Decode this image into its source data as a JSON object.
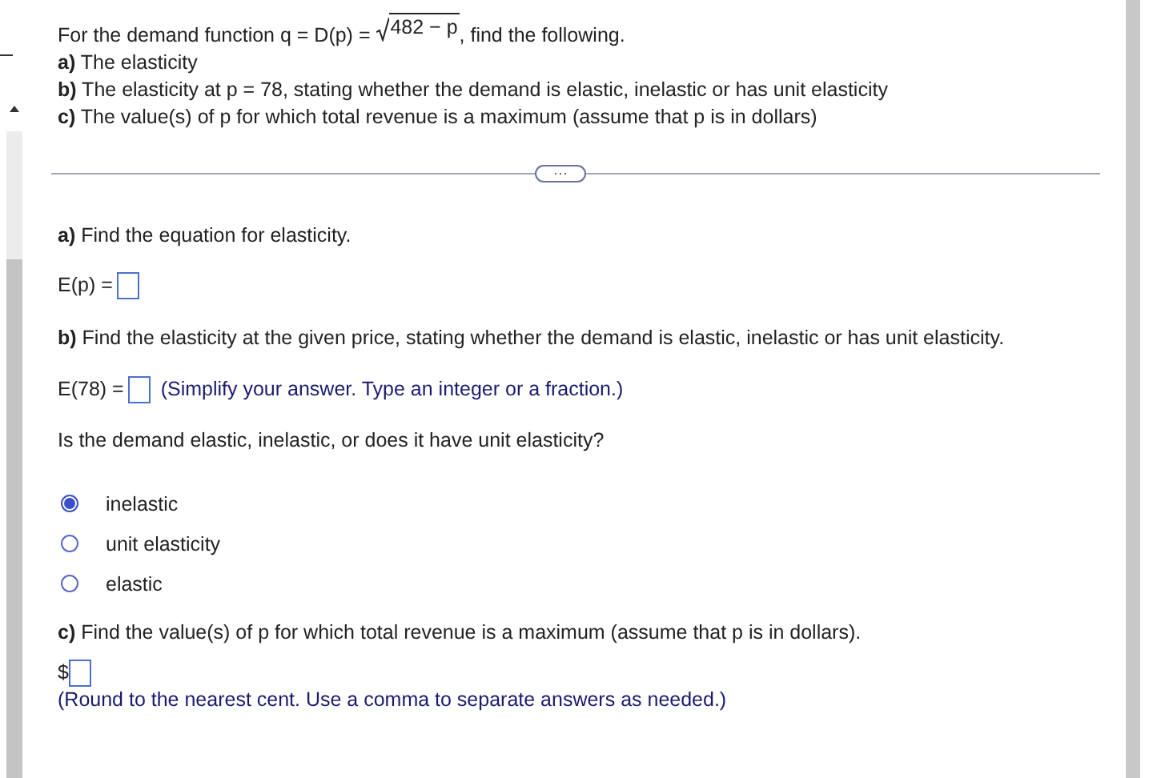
{
  "question": {
    "intro_before": "For the demand function q = D(p) = ",
    "radicand": "482 −  p",
    "intro_after": ", find the following.",
    "parts": [
      "**a)** The elasticity",
      "**b)** The elasticity at p = 78, stating whether the demand is elastic, inelastic or has unit elasticity",
      "**c)** The value(s) of p for which total revenue is a maximum (assume that p is in dollars)"
    ]
  },
  "expand_button": "···",
  "part_a": {
    "prompt": "**a)** Find the equation for elasticity.",
    "label": "E(p) ="
  },
  "part_b": {
    "prompt": "**b)** Find the elasticity at the given price, stating whether the demand is elastic, inelastic or has unit elasticity.",
    "label": "E(78) =",
    "hint": "(Simplify your answer. Type an integer or a fraction.)",
    "question": "Is the demand elastic, inelastic, or does it have unit elasticity?",
    "options": [
      {
        "label": "inelastic",
        "selected": true
      },
      {
        "label": "unit elasticity",
        "selected": false
      },
      {
        "label": "elastic",
        "selected": false
      }
    ]
  },
  "part_c": {
    "prompt": "**c)** Find the value(s) of p for which total revenue is a maximum (assume that p is in dollars).",
    "prefix": "$",
    "hint": "(Round to the nearest cent. Use a comma to separate answers as needed.)"
  }
}
